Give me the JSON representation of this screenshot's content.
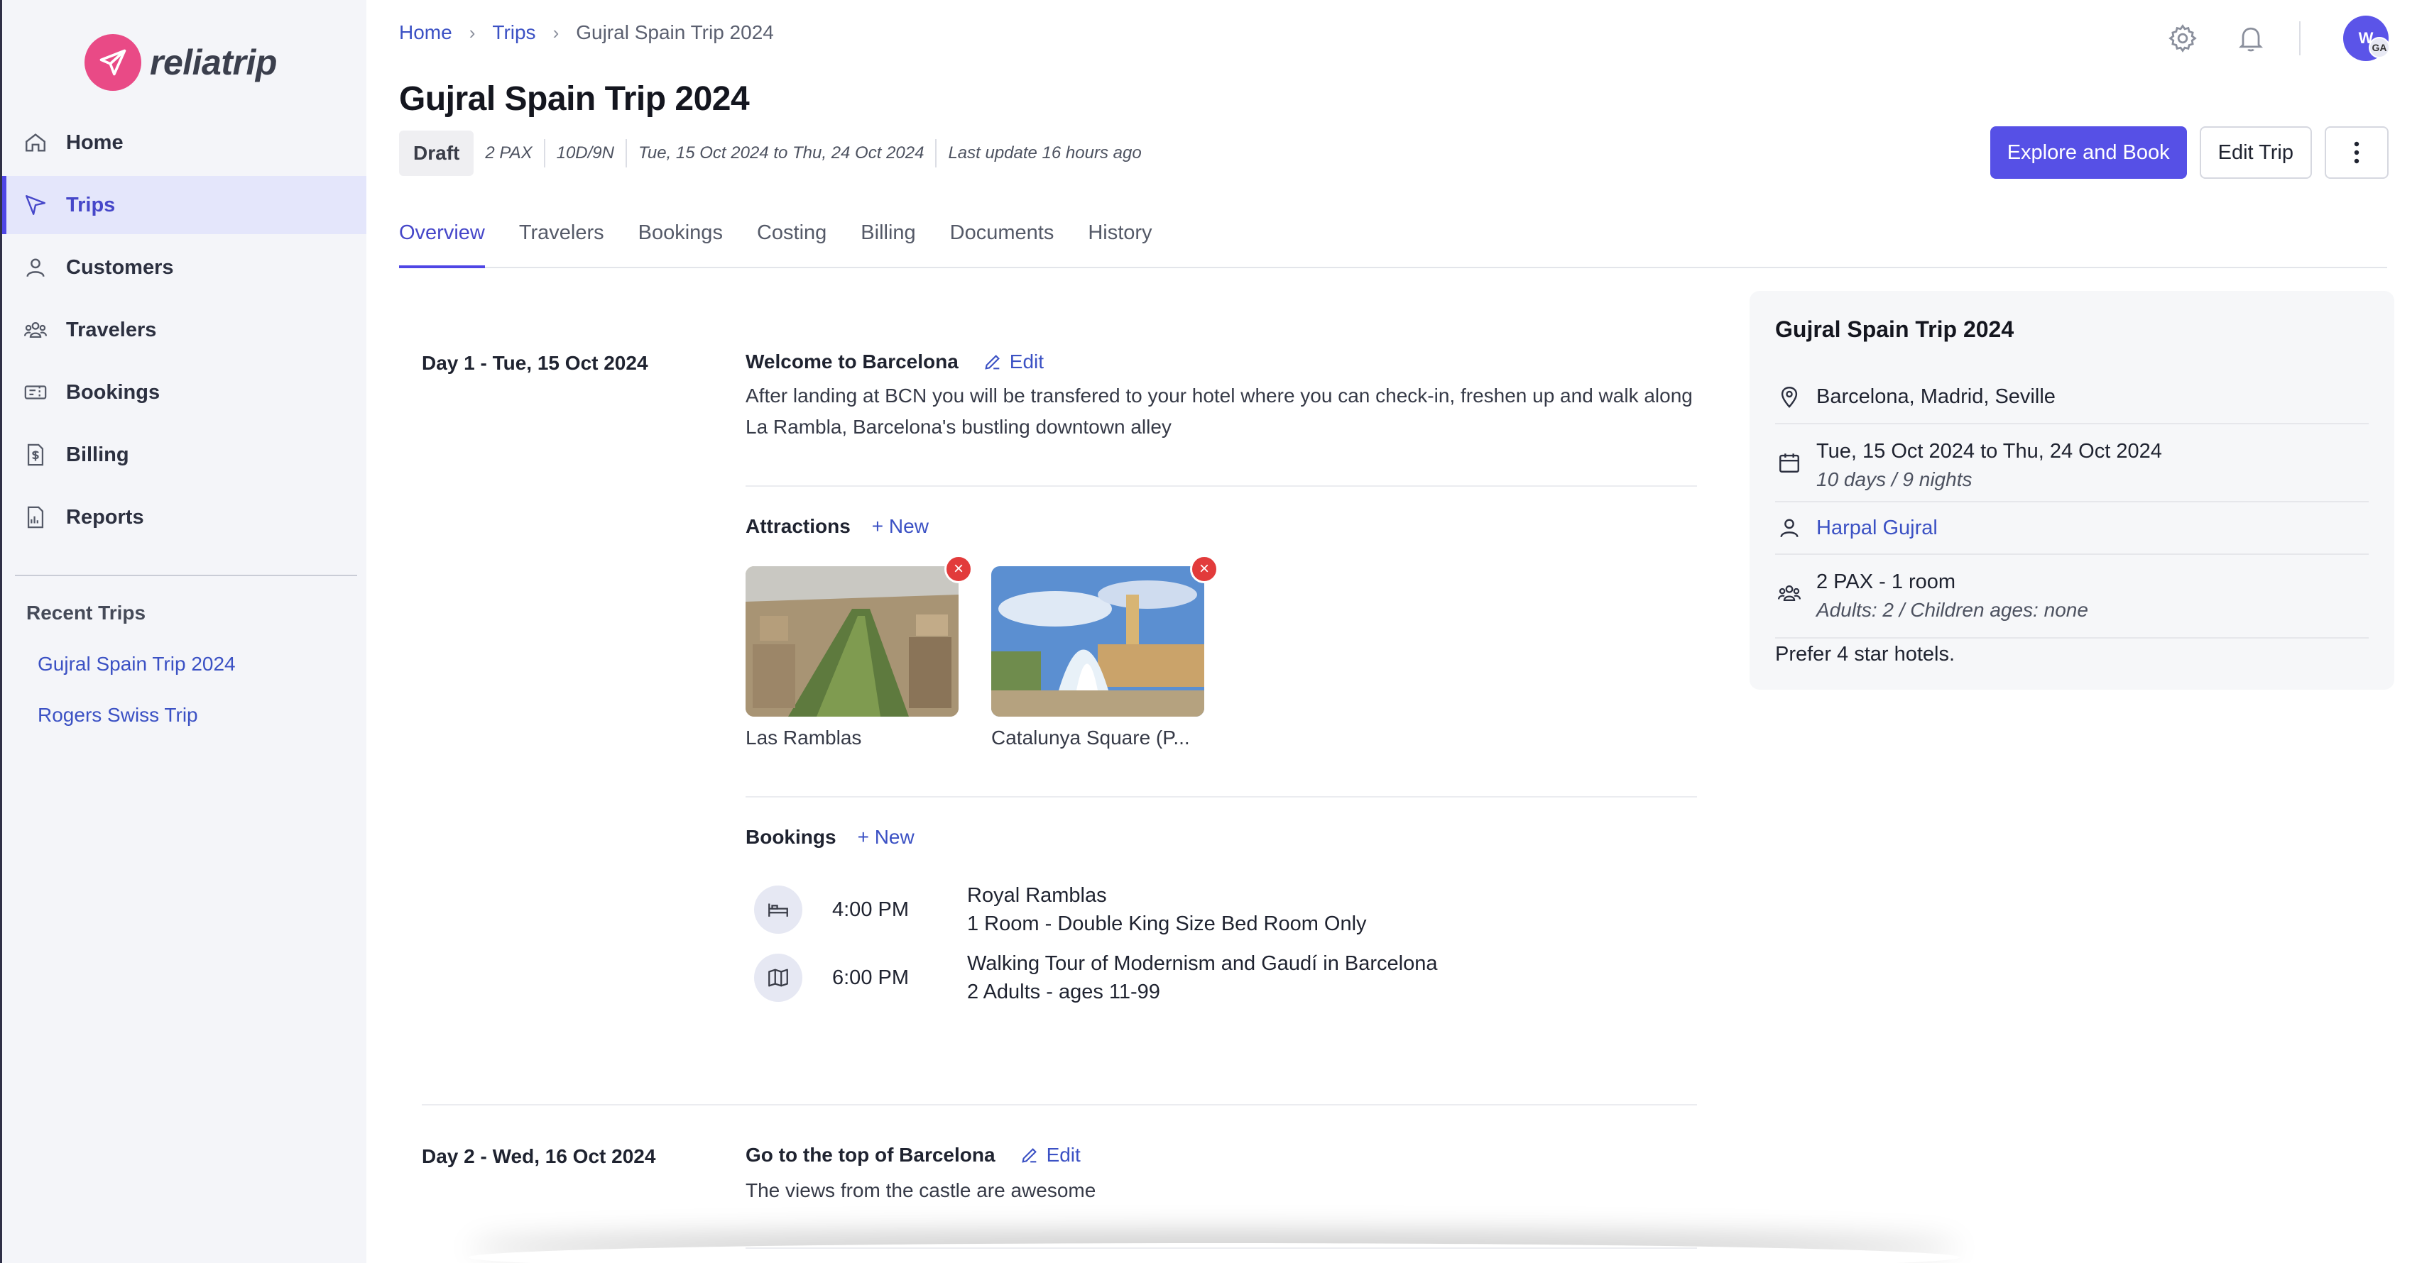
{
  "app": {
    "name": "reliatrip",
    "brand_color": "#e94a86",
    "accent": "#5650e6"
  },
  "sidebar": {
    "items": [
      {
        "label": "Home",
        "icon": "home-icon"
      },
      {
        "label": "Trips",
        "icon": "send-icon",
        "active": true
      },
      {
        "label": "Customers",
        "icon": "user-icon"
      },
      {
        "label": "Travelers",
        "icon": "users-icon"
      },
      {
        "label": "Bookings",
        "icon": "ticket-icon"
      },
      {
        "label": "Billing",
        "icon": "invoice-icon"
      },
      {
        "label": "Reports",
        "icon": "report-icon"
      }
    ],
    "recent_title": "Recent Trips",
    "recent": [
      "Gujral Spain Trip 2024",
      "Rogers Swiss Trip"
    ]
  },
  "breadcrumb": {
    "home": "Home",
    "trips": "Trips",
    "current": "Gujral Spain Trip 2024"
  },
  "header": {
    "title": "Gujral Spain Trip 2024",
    "status": "Draft",
    "pax": "2 PAX",
    "duration": "10D/9N",
    "dates": "Tue, 15 Oct 2024 to Thu, 24 Oct 2024",
    "updated": "Last update 16 hours ago",
    "explore_label": "Explore and Book",
    "edit_label": "Edit Trip"
  },
  "user": {
    "initials": "W",
    "badge": "GA"
  },
  "tabs": [
    "Overview",
    "Travelers",
    "Bookings",
    "Costing",
    "Billing",
    "Documents",
    "History"
  ],
  "days": [
    {
      "label": "Day 1 - Tue, 15 Oct 2024",
      "title": "Welcome to Barcelona",
      "edit": "Edit",
      "description": "After landing at BCN you will be transfered to your hotel where you can check-in, freshen up and walk along La Rambla, Barcelona's bustling downtown alley",
      "attractions_title": "Attractions",
      "new_label": "+ New",
      "attractions": [
        "Las Ramblas",
        "Catalunya Square (P..."
      ],
      "bookings_title": "Bookings",
      "bookings": [
        {
          "time": "4:00 PM",
          "name": "Royal Ramblas",
          "detail": "1 Room - Double King Size Bed Room Only",
          "icon": "bed-icon"
        },
        {
          "time": "6:00 PM",
          "name": "Walking Tour of Modernism and Gaudí in Barcelona",
          "detail": "2 Adults - ages 11-99",
          "icon": "map-icon"
        }
      ]
    },
    {
      "label": "Day 2 - Wed, 16 Oct 2024",
      "title": "Go to the top of Barcelona",
      "edit": "Edit",
      "description": "The views from the castle are awesome"
    }
  ],
  "summary": {
    "title": "Gujral Spain Trip 2024",
    "cities": "Barcelona, Madrid, Seville",
    "dates": "Tue, 15 Oct 2024 to Thu, 24 Oct 2024",
    "nights": "10 days / 9 nights",
    "customer": "Harpal Gujral",
    "pax": "2 PAX - 1 room",
    "ages": "Adults: 2 / Children ages: none",
    "note": "Prefer 4 star hotels."
  }
}
